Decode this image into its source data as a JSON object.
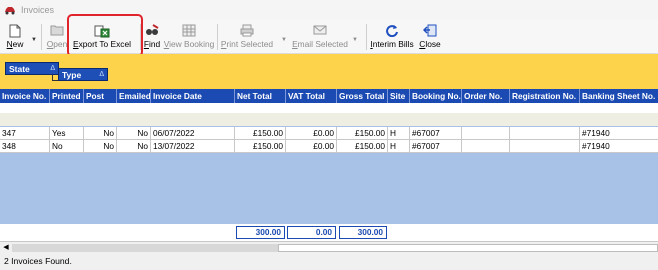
{
  "window": {
    "title": "Invoices"
  },
  "toolbar": {
    "new_label": "New",
    "open_label": "Open",
    "export_label": "Export To Excel",
    "find_label": "Find",
    "view_booking_label": "View Booking",
    "print_selected_label": "Print Selected",
    "email_selected_label": "Email Selected",
    "interim_bills_label": "Interim Bills",
    "close_label": "Close"
  },
  "grouping": {
    "chips": [
      {
        "label": "State"
      },
      {
        "label": "Type"
      }
    ],
    "sort_glyph": "Δ"
  },
  "grid": {
    "columns": [
      "Invoice No.",
      "Printed",
      "Post",
      "Emailed",
      "Invoice Date",
      "Net Total",
      "VAT Total",
      "Gross Total",
      "Site",
      "Booking No.",
      "Order No.",
      "Registration No.",
      "Banking Sheet No."
    ],
    "rows": [
      {
        "invoice_no": "347",
        "printed": "Yes",
        "post": "No",
        "emailed": "No",
        "invoice_date": "06/07/2022",
        "net_total": "£150.00",
        "vat_total": "£0.00",
        "gross_total": "£150.00",
        "site": "H",
        "booking_no": "#67007",
        "order_no": "",
        "registration_no": "",
        "banking_sheet_no": "#71940"
      },
      {
        "invoice_no": "348",
        "printed": "No",
        "post": "No",
        "emailed": "No",
        "invoice_date": "13/07/2022",
        "net_total": "£150.00",
        "vat_total": "£0.00",
        "gross_total": "£150.00",
        "site": "H",
        "booking_no": "#67007",
        "order_no": "",
        "registration_no": "",
        "banking_sheet_no": "#71940"
      }
    ],
    "totals": {
      "net": "300.00",
      "vat": "0.00",
      "gross": "300.00"
    }
  },
  "status": {
    "text": "2 Invoices Found."
  },
  "colors": {
    "header": "#1b4ab2",
    "group_band": "#fcd34b",
    "body": "#a7c2e6",
    "highlight": "#e0242b"
  }
}
